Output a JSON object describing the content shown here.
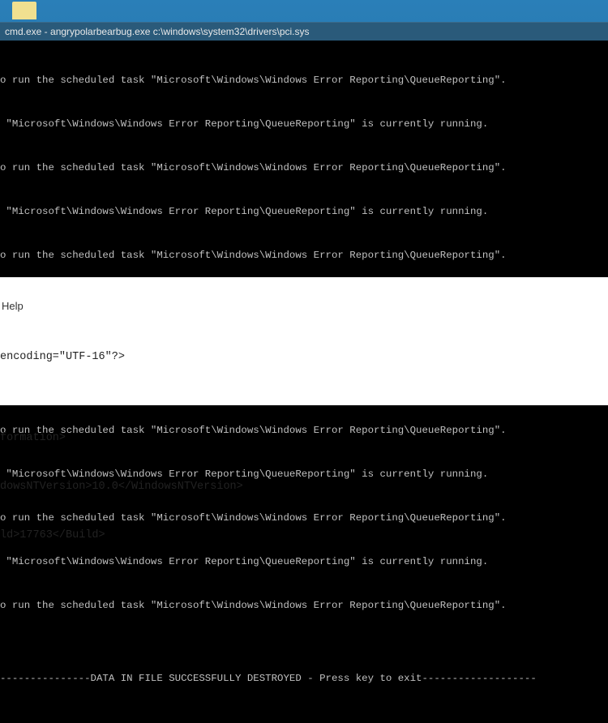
{
  "titlebar": {
    "text": "cmd.exe - angrypolarbearbug.exe  c:\\windows\\system32\\drivers\\pci.sys"
  },
  "console": {
    "lines": [
      "o run the scheduled task \"Microsoft\\Windows\\Windows Error Reporting\\QueueReporting\".",
      " \"Microsoft\\Windows\\Windows Error Reporting\\QueueReporting\" is currently running.",
      "o run the scheduled task \"Microsoft\\Windows\\Windows Error Reporting\\QueueReporting\".",
      " \"Microsoft\\Windows\\Windows Error Reporting\\QueueReporting\" is currently running.",
      "o run the scheduled task \"Microsoft\\Windows\\Windows Error Reporting\\QueueReporting\".",
      " \"Microsoft\\Windows\\Windows Error Reporting\\QueueReporting\" is currently running.",
      "o run the scheduled task \"Microsoft\\Windows\\Windows Error Reporting\\QueueReporting\".",
      " \"Microsoft\\Windows\\Windows Error Reporting\\QueueReporting\" is currently running.",
      "o run the scheduled task \"Microsoft\\Windows\\Windows Error Reporting\\QueueReporting\".",
      " \"Microsoft\\Windows\\Windows Error Reporting\\QueueReporting\" is currently running.",
      "o run the scheduled task \"Microsoft\\Windows\\Windows Error Reporting\\QueueReporting\".",
      " \"Microsoft\\Windows\\Windows Error Reporting\\QueueReporting\" is currently running.",
      "o run the scheduled task \"Microsoft\\Windows\\Windows Error Reporting\\QueueReporting\".",
      "",
      "---------------DATA IN FILE SUCCESSFULLY DESTROYED - Press key to exit-------------------"
    ]
  },
  "lower": {
    "menu": "Help",
    "lines": [
      "encoding=\"UTF-16\"?>",
      "",
      "formation>",
      "dowsNTVersion>10.0</WindowsNTVersion>",
      "ld>17763</Build>"
    ]
  }
}
